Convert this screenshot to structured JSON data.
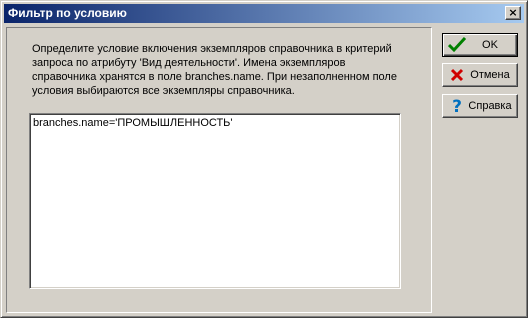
{
  "window": {
    "title": "Фильтр по условию",
    "close_label": "×"
  },
  "description": "Определите условие включения экземпляров справочника в критерий запроса по атрибуту 'Вид деятельности'. Имена экземпляров справочника хранятся в поле branches.name. При незаполненном поле условия выбираются все экземпляры справочника.",
  "condition": {
    "value": "branches.name='ПРОМЫШЛЕННОСТЬ'"
  },
  "buttons": {
    "ok": {
      "label": "OK",
      "icon": "check-icon",
      "color": "#008000"
    },
    "cancel": {
      "label": "Отмена",
      "icon": "x-icon",
      "color": "#d00000"
    },
    "help": {
      "label": "Справка",
      "icon": "question-icon",
      "color": "#0070c0"
    }
  }
}
